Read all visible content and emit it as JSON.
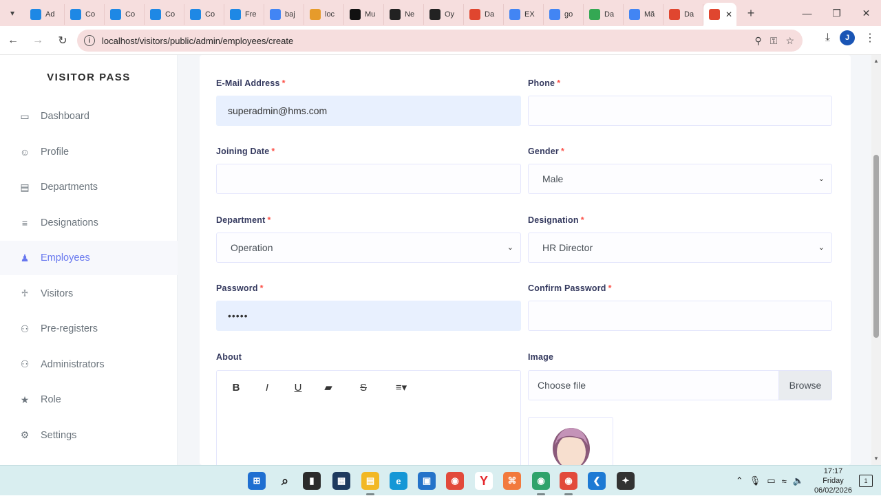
{
  "browser": {
    "tabs": [
      {
        "label": "Ad",
        "icon": "word-icon",
        "color": "#1e88e5"
      },
      {
        "label": "Co",
        "icon": "shield-icon",
        "color": "#1e88e5"
      },
      {
        "label": "Co",
        "icon": "shield-icon",
        "color": "#1e88e5"
      },
      {
        "label": "Co",
        "icon": "shield-icon",
        "color": "#1e88e5"
      },
      {
        "label": "Co",
        "icon": "shield-icon",
        "color": "#1e88e5"
      },
      {
        "label": "Fre",
        "icon": "shield-icon",
        "color": "#1e88e5"
      },
      {
        "label": "baj",
        "icon": "google-icon",
        "color": "#4285f4"
      },
      {
        "label": "loc",
        "icon": "chart-icon",
        "color": "#e69b2b"
      },
      {
        "label": "Mu",
        "icon": "leaf-icon",
        "color": "#111111"
      },
      {
        "label": "Ne",
        "icon": "github-icon",
        "color": "#222222"
      },
      {
        "label": "Oy",
        "icon": "openai-icon",
        "color": "#222222"
      },
      {
        "label": "Da",
        "icon": "xampp-icon",
        "color": "#e0462f"
      },
      {
        "label": "EX",
        "icon": "google-icon",
        "color": "#4285f4"
      },
      {
        "label": "go",
        "icon": "google-icon",
        "color": "#4285f4"
      },
      {
        "label": "Da",
        "icon": "maps-icon",
        "color": "#34a853"
      },
      {
        "label": "Mă",
        "icon": "google-icon",
        "color": "#4285f4"
      },
      {
        "label": "Da",
        "icon": "xampp-icon",
        "color": "#e0462f"
      }
    ],
    "active_tab": {
      "icon": "xampp-icon",
      "color": "#e0462f"
    },
    "url": "localhost/visitors/public/admin/employees/create",
    "profile_initial": "J"
  },
  "sidebar": {
    "brand": "VISITOR PASS",
    "items": [
      {
        "label": "Dashboard",
        "icon": "laptop-icon",
        "glyph": "▭"
      },
      {
        "label": "Profile",
        "icon": "user-icon",
        "glyph": "☺"
      },
      {
        "label": "Departments",
        "icon": "building-icon",
        "glyph": "▤"
      },
      {
        "label": "Designations",
        "icon": "layers-icon",
        "glyph": "≡"
      },
      {
        "label": "Employees",
        "icon": "user-tie-icon",
        "glyph": "♟"
      },
      {
        "label": "Visitors",
        "icon": "walking-icon",
        "glyph": "♱"
      },
      {
        "label": "Pre-registers",
        "icon": "user-friends-icon",
        "glyph": "⚇"
      },
      {
        "label": "Administrators",
        "icon": "users-icon",
        "glyph": "⚇"
      },
      {
        "label": "Role",
        "icon": "star-icon",
        "glyph": "★"
      },
      {
        "label": "Settings",
        "icon": "cogs-icon",
        "glyph": "⚙"
      }
    ],
    "active": "Employees"
  },
  "form": {
    "email_label": "E-Mail Address",
    "email_value": "superadmin@hms.com",
    "phone_label": "Phone",
    "phone_value": "",
    "joining_label": "Joining Date",
    "joining_value": "",
    "gender_label": "Gender",
    "gender_value": "Male",
    "department_label": "Department",
    "department_value": "Operation",
    "designation_label": "Designation",
    "designation_value": "HR Director",
    "password_label": "Password",
    "password_value": "•••••",
    "confirm_label": "Confirm Password",
    "confirm_value": "",
    "about_label": "About",
    "image_label": "Image",
    "file_placeholder": "Choose file",
    "browse_label": "Browse",
    "required_mark": "*",
    "editor_tools": [
      {
        "name": "bold-button",
        "glyph": "B"
      },
      {
        "name": "italic-button",
        "glyph": "I"
      },
      {
        "name": "underline-button",
        "glyph": "U"
      },
      {
        "name": "eraser-button",
        "glyph": "▰"
      },
      {
        "name": "strikethrough-button",
        "glyph": "S"
      },
      {
        "name": "align-button",
        "glyph": "≡▾"
      }
    ]
  },
  "taskbar": {
    "time": "17:17",
    "day": "Friday",
    "date": "06/02/2026",
    "notification_count": "1",
    "apps": [
      {
        "name": "start-icon",
        "color": "#1f6fd1",
        "glyph": "⊞"
      },
      {
        "name": "search-icon",
        "color": "#d9eef0",
        "glyph": "⌕"
      },
      {
        "name": "terminal-icon",
        "color": "#2b2b2b",
        "glyph": "▮"
      },
      {
        "name": "widgets-icon",
        "color": "#1e3a5f",
        "glyph": "▦"
      },
      {
        "name": "file-explorer-icon",
        "color": "#f2b824",
        "glyph": "▤"
      },
      {
        "name": "edge-icon",
        "color": "#1597d6",
        "glyph": "e"
      },
      {
        "name": "store-icon",
        "color": "#2473c9",
        "glyph": "▣"
      },
      {
        "name": "chrome-icon",
        "color": "#e24a3b",
        "glyph": "◉"
      },
      {
        "name": "yandex-icon",
        "color": "#ffffff",
        "glyph": "Y"
      },
      {
        "name": "xampp-icon",
        "color": "#f27a3d",
        "glyph": "⌘"
      },
      {
        "name": "chrome-profile-icon",
        "color": "#2fa36b",
        "glyph": "◉"
      },
      {
        "name": "chrome-alt-icon",
        "color": "#e24a3b",
        "glyph": "◉"
      },
      {
        "name": "vscode-icon",
        "color": "#1d7ad4",
        "glyph": "❮"
      },
      {
        "name": "app-icon",
        "color": "#333333",
        "glyph": "✦"
      }
    ]
  }
}
